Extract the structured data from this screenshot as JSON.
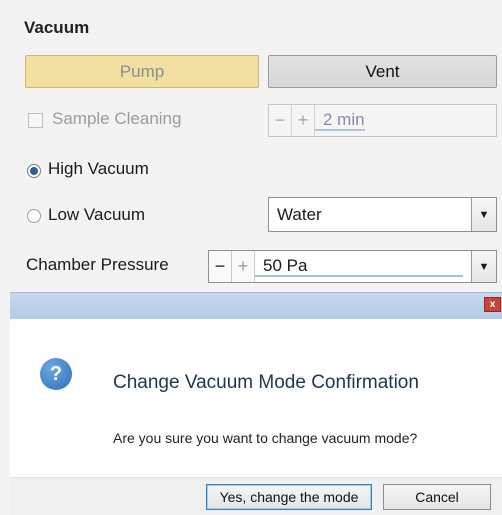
{
  "vacuum": {
    "title": "Vacuum",
    "pump_label": "Pump",
    "vent_label": "Vent",
    "sample_cleaning": {
      "label": "Sample Cleaning",
      "checked": false,
      "minus": "−",
      "plus": "+",
      "value": "2 min"
    },
    "high_vacuum": {
      "label": "High Vacuum",
      "selected": true
    },
    "low_vacuum": {
      "label": "Low Vacuum",
      "selected": false
    },
    "low_vacuum_gas": {
      "value": "Water"
    },
    "chamber_pressure": {
      "label": "Chamber Pressure",
      "minus": "−",
      "plus": "+",
      "value": "50 Pa"
    }
  },
  "dialog": {
    "close_glyph": "x",
    "icon_glyph": "?",
    "heading": "Change Vacuum Mode Confirmation",
    "message": "Are you sure you want to change vacuum mode?",
    "confirm_label": "Yes, change the mode",
    "cancel_label": "Cancel"
  }
}
